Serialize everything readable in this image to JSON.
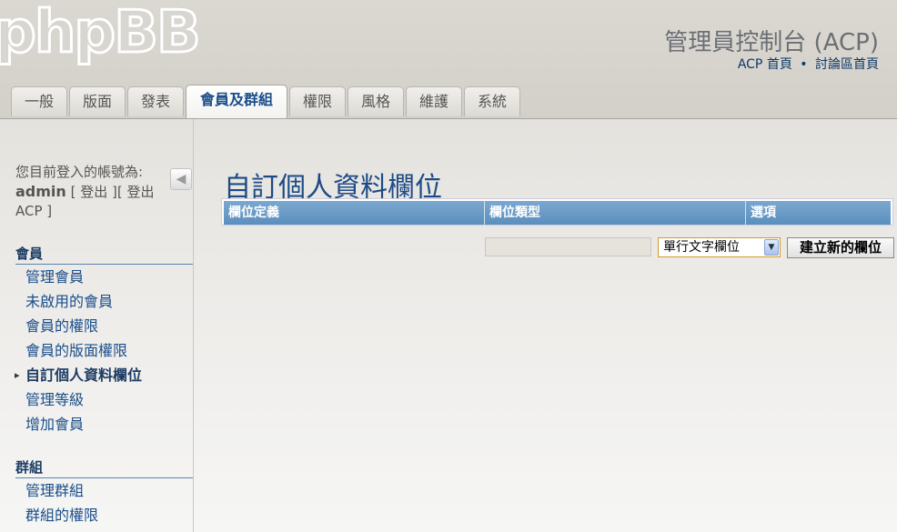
{
  "header": {
    "logo": "phpBB",
    "title": "管理員控制台 (ACP)",
    "links": [
      "ACP 首頁",
      "討論區首頁"
    ],
    "link_separator": "•"
  },
  "tabs": [
    {
      "label": "一般"
    },
    {
      "label": "版面"
    },
    {
      "label": "發表"
    },
    {
      "label": "會員及群組",
      "active": true
    },
    {
      "label": "權限"
    },
    {
      "label": "風格"
    },
    {
      "label": "維護"
    },
    {
      "label": "系統"
    }
  ],
  "sidebar": {
    "login_prefix": "您目前登入的帳號為:",
    "username": "admin",
    "logout_link": "登出",
    "logout_acp_link": "登出 ACP",
    "sections": [
      {
        "title": "會員",
        "items": [
          "管理會員",
          "未啟用的會員",
          "會員的權限",
          "會員的版面權限",
          "自訂個人資料欄位",
          "管理等級",
          "增加會員"
        ]
      },
      {
        "title": "群組",
        "items": [
          "管理群組",
          "群組的權限"
        ]
      }
    ],
    "active_item": "自訂個人資料欄位",
    "active_marker": "▸"
  },
  "main": {
    "title": "自訂個人資料欄位",
    "columns": [
      "欄位定義",
      "欄位類型",
      "選項"
    ],
    "field_name_value": "",
    "field_type_selected": "單行文字欄位",
    "create_button": "建立新的欄位"
  },
  "colors": {
    "accent": "#1a4e8a",
    "table_header": "#5a8fbd",
    "header_bg": "#d3d0c9"
  }
}
